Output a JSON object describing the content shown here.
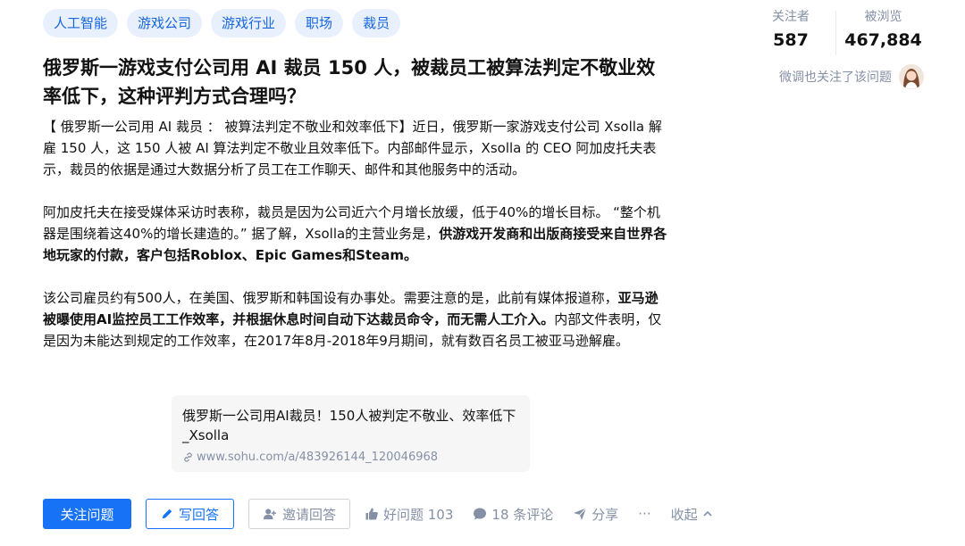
{
  "tags": [
    "人工智能",
    "游戏公司",
    "游戏行业",
    "职场",
    "裁员"
  ],
  "stats": {
    "followers_label": "关注者",
    "followers_value": "587",
    "views_label": "被浏览",
    "views_value": "467,884"
  },
  "followed_by": "微调也关注了该问题",
  "question": {
    "title": "俄罗斯一游戏支付公司用 AI 裁员 150 人，被裁员工被算法判定不敬业效率低下，这种评判方式合理吗？"
  },
  "content": {
    "p1": "【 俄罗斯一公司用 AI 裁员 ： 被算法判定不敬业和效率低下】近日，俄罗斯一家游戏支付公司 Xsolla 解雇 150 人，这 150 人被 AI 算法判定不敬业且效率低下。内部邮件显示，Xsolla 的 CEO 阿加皮托夫表示，裁员的依据是通过大数据分析了员工在工作聊天、邮件和其他服务中的活动。",
    "p2_a": "阿加皮托夫在接受媒体采访时表称，裁员是因为公司近六个月增长放缓，低于40%的增长目标。 “整个机器是围绕着这40%的增长建造的。” 据了解，Xsolla的主营业务是，",
    "p2_b": "供游戏开发商和出版商接受来自世界各地玩家的付款，客户包括Roblox、Epic Games和Steam。",
    "p3_a": "该公司雇员约有500人，在美国、俄罗斯和韩国设有办事处。需要注意的是，此前有媒体报道称，",
    "p3_b": "亚马逊被曝使用AI监控员工工作效率，并根据休息时间自动下达裁员命令，而无需人工介入。",
    "p3_c": "内部文件表明，仅是因为未能达到规定的工作效率，在2017年8月-2018年9月期间，就有数百名员工被亚马逊解雇。"
  },
  "link_card": {
    "title": "俄罗斯一公司用AI裁员！150人被判定不敬业、效率低下_Xsolla",
    "url": "www.sohu.com/a/483926144_120046968"
  },
  "actions": {
    "follow": "关注问题",
    "write": "写回答",
    "invite": "邀请回答",
    "good_question": "好问题 103",
    "comments": "18 条评论",
    "share": "分享",
    "more": "···",
    "collapse": "收起"
  },
  "colors": {
    "primary": "#1772f6",
    "tag_bg": "#e8f0fd",
    "muted": "#8590a6"
  }
}
